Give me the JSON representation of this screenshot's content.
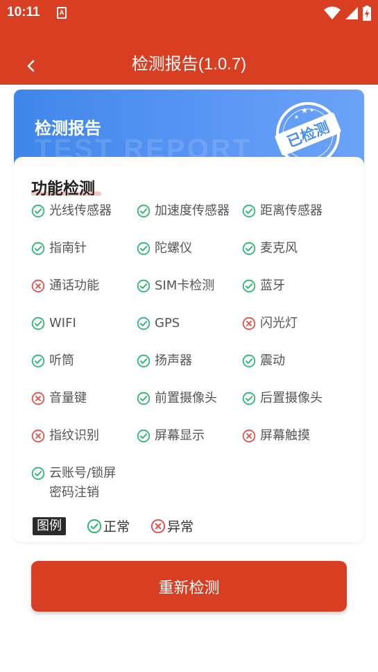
{
  "status_bar": {
    "time": "10:11",
    "sim_badge": "A"
  },
  "app_bar": {
    "title": "检测报告(1.0.7)",
    "back_icon": "chevron-left-icon"
  },
  "banner": {
    "title": "检测报告",
    "watermark": "TEST REPORT",
    "stamp_text": "已检测"
  },
  "section": {
    "title": "功能检测"
  },
  "colors": {
    "primary": "#d83f22",
    "ok": "#2bb673",
    "fail": "#e0524a",
    "banner_start": "#3f86ea"
  },
  "items": [
    {
      "label": "光线传感器",
      "status": "ok"
    },
    {
      "label": "加速度传感器",
      "status": "ok"
    },
    {
      "label": "距离传感器",
      "status": "ok"
    },
    {
      "label": "指南针",
      "status": "ok"
    },
    {
      "label": "陀螺仪",
      "status": "ok"
    },
    {
      "label": "麦克风",
      "status": "ok"
    },
    {
      "label": "通话功能",
      "status": "fail"
    },
    {
      "label": "SIM卡检测",
      "status": "ok"
    },
    {
      "label": "蓝牙",
      "status": "ok"
    },
    {
      "label": "WIFI",
      "status": "ok"
    },
    {
      "label": "GPS",
      "status": "ok"
    },
    {
      "label": "闪光灯",
      "status": "fail"
    },
    {
      "label": "听筒",
      "status": "ok"
    },
    {
      "label": "扬声器",
      "status": "ok"
    },
    {
      "label": "震动",
      "status": "ok"
    },
    {
      "label": "音量键",
      "status": "fail"
    },
    {
      "label": "前置摄像头",
      "status": "ok"
    },
    {
      "label": "后置摄像头",
      "status": "ok"
    },
    {
      "label": "指纹识别",
      "status": "fail"
    },
    {
      "label": "屏幕显示",
      "status": "ok"
    },
    {
      "label": "屏幕触摸",
      "status": "fail"
    },
    {
      "label": "云账号/锁屏密码注销",
      "status": "ok"
    }
  ],
  "legend": {
    "tag": "图例",
    "ok_label": "正常",
    "fail_label": "异常"
  },
  "actions": {
    "retest_label": "重新检测"
  }
}
